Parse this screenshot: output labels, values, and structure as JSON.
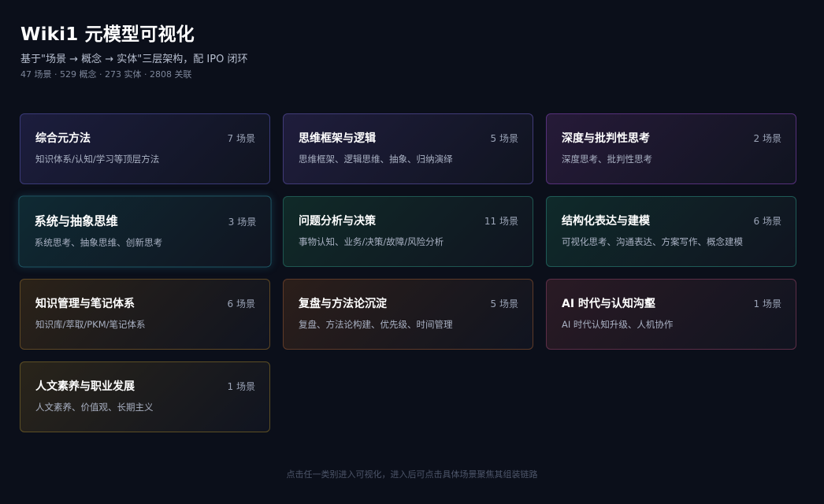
{
  "header": {
    "title": "Wiki1 元模型可视化",
    "subtitle": "基于\"场景 → 概念 → 实体\"三层架构，配 IPO 闭环",
    "stats": "47 场景 · 529 概念 · 273 实体 · 2808 关联"
  },
  "cards": [
    {
      "title": "综合元方法",
      "count": "7 场景",
      "desc": "知识体系/认知/学习等顶层方法",
      "bg": "#1c1d3d",
      "border": "#3a3a78"
    },
    {
      "title": "思维框架与逻辑",
      "count": "5 场景",
      "desc": "思维框架、逻辑思维、抽象、归纳演绎",
      "bg": "#1f1d3c",
      "border": "#413b78"
    },
    {
      "title": "深度与批判性思考",
      "count": "2 场景",
      "desc": "深度思考、批判性思考",
      "bg": "#261a38",
      "border": "#55307a"
    },
    {
      "title": "系统与抽象思维",
      "count": "3 场景",
      "desc": "系统思考、抽象思维、创新思考",
      "bg": "#0f2a33",
      "border": "#1e5563"
    },
    {
      "title": "问题分析与决策",
      "count": "11 场景",
      "desc": "事物认知、业务/决策/故障/风险分析",
      "bg": "#102a28",
      "border": "#1e5650"
    },
    {
      "title": "结构化表达与建模",
      "count": "6 场景",
      "desc": "可视化思考、沟通表达、方案写作、概念建模",
      "bg": "#0f2a2a",
      "border": "#1e5a56"
    },
    {
      "title": "知识管理与笔记体系",
      "count": "6 场景",
      "desc": "知识库/萃取/PKM/笔记体系",
      "bg": "#2b2218",
      "border": "#5e4724"
    },
    {
      "title": "复盘与方法论沉淀",
      "count": "5 场景",
      "desc": "复盘、方法论构建、优先级、时间管理",
      "bg": "#2b1e1a",
      "border": "#5e3a28"
    },
    {
      "title": "AI 时代与认知沟壑",
      "count": "1 场景",
      "desc": "AI 时代认知升级、人机协作",
      "bg": "#2a1a24",
      "border": "#5c2e47"
    },
    {
      "title": "人文素养与职业发展",
      "count": "1 场景",
      "desc": "人文素养、价值观、长期主义",
      "bg": "#29241a",
      "border": "#5c4e24"
    }
  ],
  "footer": "点击任一类别进入可视化，进入后可点击具体场景聚焦其组装链路"
}
